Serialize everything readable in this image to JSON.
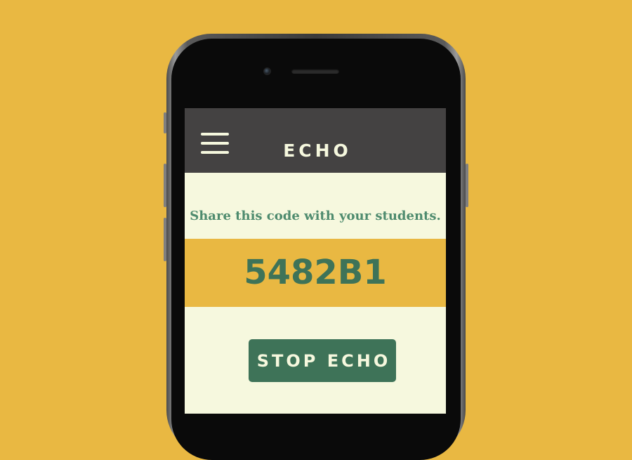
{
  "header": {
    "title": "ECHO",
    "menu_icon": "hamburger-menu-icon"
  },
  "main": {
    "instruction": "Share this code with your students.",
    "code": "5482B1",
    "stop_button_label": "STOP ECHO"
  },
  "colors": {
    "background": "#E9B842",
    "header": "#444242",
    "screen": "#F6F8DE",
    "accent_green": "#3E7358",
    "instruction_green": "#4E8B6E",
    "code_band": "#E9B842"
  }
}
